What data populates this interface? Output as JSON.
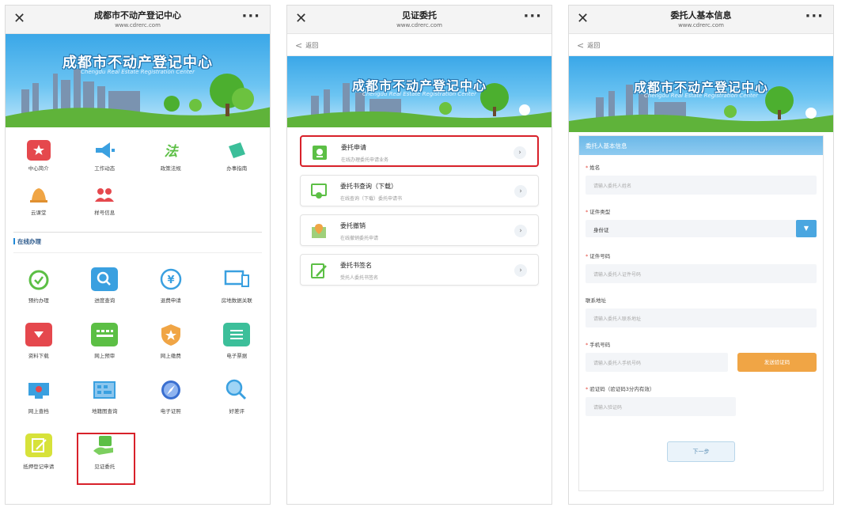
{
  "common": {
    "url": "www.cdrerc.com",
    "back_label": "返回",
    "banner_title": "成都市不动产登记中心",
    "banner_subtitle": "Chengdu Real Estate Registration Center"
  },
  "phone1": {
    "title": "成都市不动产登记中心",
    "top_items": [
      {
        "label": "中心简介",
        "icon": "star-flag-icon",
        "color": "#e5484d"
      },
      {
        "label": "工作动态",
        "icon": "megaphone-icon",
        "color": "#3aa0e0"
      },
      {
        "label": "政策法规",
        "icon": "law-text-icon",
        "color": "#5cbf45"
      },
      {
        "label": "办事指南",
        "icon": "guide-book-icon",
        "color": "#3cbf9a"
      },
      {
        "label": "云课堂",
        "icon": "bell-icon",
        "color": "#f0a545"
      },
      {
        "label": "样号信息",
        "icon": "people-icon",
        "color": "#e5484d"
      }
    ],
    "section_title": "在线办理",
    "online_items": [
      {
        "label": "预约办理",
        "icon": "alarm-clock-icon",
        "color": "#5cbf45"
      },
      {
        "label": "进度查询",
        "icon": "magnifier-icon",
        "color": "#3aa0e0"
      },
      {
        "label": "退费申请",
        "icon": "yen-refund-icon",
        "color": "#3aa0e0"
      },
      {
        "label": "房地数据关联",
        "icon": "devices-icon",
        "color": "#3aa0e0"
      },
      {
        "label": "资料下载",
        "icon": "download-icon",
        "color": "#e5484d"
      },
      {
        "label": "网上预审",
        "icon": "keyboard-icon",
        "color": "#5cbf45"
      },
      {
        "label": "网上缴费",
        "icon": "shield-star-icon",
        "color": "#f0a545"
      },
      {
        "label": "电子票据",
        "icon": "receipt-icon",
        "color": "#3cbf9a"
      },
      {
        "label": "网上查档",
        "icon": "archive-icon",
        "color": "#3aa0e0"
      },
      {
        "label": "地籍图查询",
        "icon": "map-grid-icon",
        "color": "#3aa0e0"
      },
      {
        "label": "电子证照",
        "icon": "compass-icon",
        "color": "#3a6fd0"
      },
      {
        "label": "好差评",
        "icon": "search-rate-icon",
        "color": "#3aa0e0"
      },
      {
        "label": "抵押登记申请",
        "icon": "edit-note-icon",
        "color": "#c9d63a"
      },
      {
        "label": "见证委托",
        "icon": "hand-doc-icon",
        "color": "#5cbf45"
      }
    ]
  },
  "phone2": {
    "title": "见证委托",
    "items": [
      {
        "title": "委托申请",
        "subtitle": "在线办理委托申请业务",
        "icon": "certificate-icon"
      },
      {
        "title": "委托书查询（下载）",
        "subtitle": "在线查询（下载）委托申请书",
        "icon": "award-doc-icon"
      },
      {
        "title": "委托撤销",
        "subtitle": "在线撤销委托申请",
        "icon": "map-pin-doc-icon"
      },
      {
        "title": "委托书签名",
        "subtitle": "受托人委托书签名",
        "icon": "sign-pen-icon"
      }
    ]
  },
  "phone3": {
    "title": "委托人基本信息",
    "form_header": "委托人基本信息",
    "fields": {
      "name_label": "姓名",
      "name_placeholder": "请输入委托人姓名",
      "idtype_label": "证件类型",
      "idtype_value": "身份证",
      "idno_label": "证件号码",
      "idno_placeholder": "请输入委托人证件号码",
      "address_label": "联系地址",
      "address_placeholder": "请输入委托人联系地址",
      "phone_label": "手机号码",
      "phone_placeholder": "请输入委托人手机号码",
      "send_code_label": "发送验证码",
      "code_label": "验证码（验证码3分内有效）",
      "code_placeholder": "请输入验证码",
      "next_label": "下一步"
    }
  }
}
